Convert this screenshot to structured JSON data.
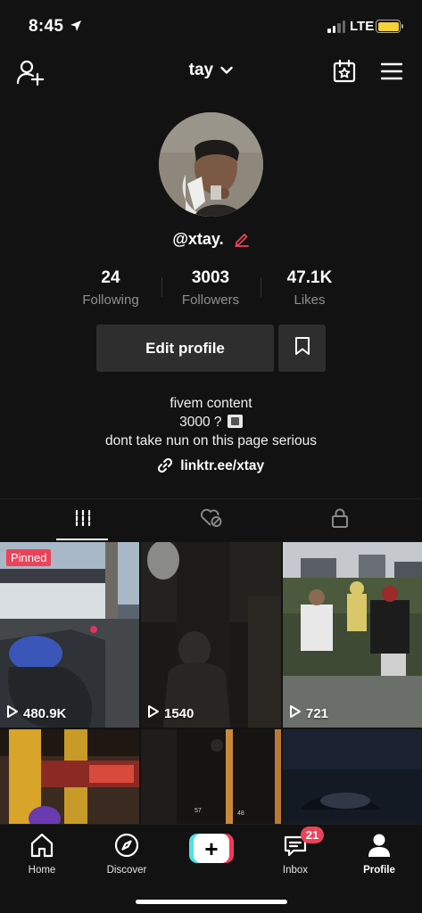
{
  "status_bar": {
    "time": "8:45",
    "network": "LTE",
    "battery_color": "#f7d038"
  },
  "header": {
    "username": "tay"
  },
  "profile": {
    "handle": "@xtay.",
    "stats": [
      {
        "value": "24",
        "label": "Following"
      },
      {
        "value": "3003",
        "label": "Followers"
      },
      {
        "value": "47.1K",
        "label": "Likes"
      }
    ],
    "edit_button": "Edit profile",
    "bio_lines": [
      "fivem content",
      "3000 ?",
      "dont take nun on this page serious"
    ],
    "link": "linktr.ee/xtay"
  },
  "tabs": [
    {
      "icon": "videos-grid-icon",
      "active": true
    },
    {
      "icon": "liked-hidden-icon",
      "active": false
    },
    {
      "icon": "lock-icon",
      "active": false
    }
  ],
  "videos": [
    {
      "views": "480.9K",
      "pinned_label": "Pinned"
    },
    {
      "views": "1540"
    },
    {
      "views": "721"
    }
  ],
  "bottom_nav": {
    "home": "Home",
    "discover": "Discover",
    "inbox": "Inbox",
    "inbox_badge": "21",
    "profile": "Profile"
  },
  "colors": {
    "accent": "#ea4359",
    "background": "#121212",
    "cyan": "#4ee0e8"
  }
}
